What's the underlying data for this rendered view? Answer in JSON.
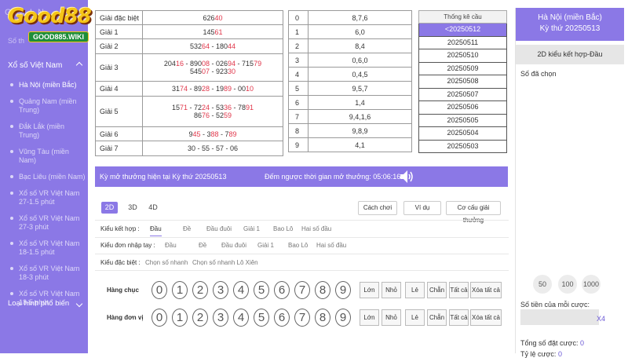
{
  "sidebar": {
    "logo_text": "Good88",
    "logo_sub": "GOOD885.WIKI",
    "ghost_top": "G  M I N",
    "ghost_sub": "Số th",
    "section": "Xổ số Việt Nam",
    "items": [
      {
        "label": "Hà Nội (miền Bắc)"
      },
      {
        "label": "Quảng Nam (miền Trung)"
      },
      {
        "label": "Đắk Lắk (miền Trung)"
      },
      {
        "label": "Vũng Tàu (miền Nam)"
      },
      {
        "label": "Bạc Liêu (miền Nam)"
      },
      {
        "label": "Xổ số VR Việt Nam 27-1.5 phút"
      },
      {
        "label": "Xổ số VR Việt Nam 27-3 phút"
      },
      {
        "label": "Xổ số VR Việt Nam 18-1.5 phút"
      },
      {
        "label": "Xổ số VR Việt Nam 18-3 phút"
      },
      {
        "label": "Xổ số VR Việt Nam 18-5 phút"
      }
    ],
    "bottom": "Loại hình phổ biến"
  },
  "prizes": {
    "special": {
      "label": "Giải đặc biệt",
      "plain": "626",
      "red": "40"
    },
    "g1": {
      "label": "Giải 1",
      "plain": "145",
      "red": "61"
    },
    "g2": {
      "label": "Giải 2",
      "a": "532",
      "ar": "64",
      "sep": " - ",
      "b": "180",
      "br": "44"
    },
    "g3": {
      "label": "Giải 3",
      "l1": [
        [
          "204",
          "16"
        ],
        [
          "890",
          "08"
        ],
        [
          "026",
          "94"
        ],
        [
          "715",
          "79"
        ]
      ],
      "l2": [
        [
          "545",
          "07"
        ],
        [
          "923",
          "30"
        ]
      ]
    },
    "g4": {
      "label": "Giải 4",
      "nums": [
        [
          "31",
          "74"
        ],
        [
          "89",
          "28"
        ],
        [
          "19",
          "89"
        ],
        [
          "00",
          "10"
        ]
      ]
    },
    "g5": {
      "label": "Giải 5",
      "l1": [
        [
          "15",
          "71"
        ],
        [
          "72",
          "24"
        ],
        [
          "53",
          "36"
        ],
        [
          "78",
          "91"
        ]
      ],
      "l2": [
        [
          "86",
          "76"
        ],
        [
          "52",
          "59"
        ]
      ]
    },
    "g6": {
      "label": "Giải 6",
      "nums": [
        [
          "9",
          "45"
        ],
        [
          "3",
          "88"
        ],
        [
          "7",
          "89"
        ]
      ]
    },
    "g7": {
      "label": "Giải 7",
      "text": "30 - 55 - 57 - 06"
    }
  },
  "digits": [
    {
      "d": "0",
      "v": "8,7,6"
    },
    {
      "d": "1",
      "v": "6,0"
    },
    {
      "d": "2",
      "v": "8,4"
    },
    {
      "d": "3",
      "v": "0,6,0"
    },
    {
      "d": "4",
      "v": "0,4,5"
    },
    {
      "d": "5",
      "v": "9,5,7"
    },
    {
      "d": "6",
      "v": "1,4"
    },
    {
      "d": "7",
      "v": "9,4,1,6"
    },
    {
      "d": "8",
      "v": "9,8,9"
    },
    {
      "d": "9",
      "v": "4,1"
    }
  ],
  "stats": {
    "header": "Thống kê cầu",
    "items": [
      "<20250512",
      "20250511",
      "20250510",
      "20250509",
      "20250508",
      "20250507",
      "20250506",
      "20250505",
      "20250504",
      "20250503"
    ]
  },
  "right_panel": {
    "region": "Hà Nội (miền Bắc)",
    "period": "Kỳ thứ 20250513",
    "tab": "2D kiểu kết hợp-Đầu",
    "selected_label": "Số đã chọn",
    "chips": [
      "50",
      "100",
      "1000"
    ],
    "amount_label": "Số tiền của mỗi cược:",
    "multiplier": "X4",
    "total_label": "Tổng số đặt cược:",
    "total_value": "0",
    "rate_label": "Tỷ lệ cược:",
    "rate_value": "0"
  },
  "bar": {
    "left": "Kỳ mở thưởng hiện tại Kỳ thứ 20250513",
    "mid": "Đếm ngược thời gian mở thưởng: 05:06:16"
  },
  "bet": {
    "tabs": [
      "2D",
      "3D",
      "4D"
    ],
    "buttons": [
      "Cách chơi",
      "Ví dụ",
      "Cơ cấu giải thưởng"
    ],
    "row1_label": "Kiểu kết hợp :",
    "row1_opts": [
      "Đầu",
      "Đề",
      "Đầu đuôi",
      "Giải 1",
      "Bao Lô",
      "Hai số đầu"
    ],
    "row2_label": "Kiểu đơn nhập tay :",
    "row2_opts": [
      "Đầu",
      "Đề",
      "Đầu đuôi",
      "Giải 1",
      "Bao Lô",
      "Hai số đầu"
    ],
    "row3_label": "Kiểu đặc biệt :",
    "row3_opts": [
      "Chọn số nhanh",
      "Chọn số nhanh Lô Xiên"
    ],
    "row_tens": "Hàng chục",
    "row_units": "Hàng đơn vị",
    "balls": [
      "0",
      "1",
      "2",
      "3",
      "4",
      "5",
      "6",
      "7",
      "8",
      "9"
    ],
    "quick": [
      "Lớn",
      "Nhỏ",
      "Lẻ",
      "Chẵn",
      "Tất cả",
      "Xóa tất cả"
    ]
  },
  "colors": {
    "accent": "#8b78e6",
    "red": "#e0364a"
  }
}
